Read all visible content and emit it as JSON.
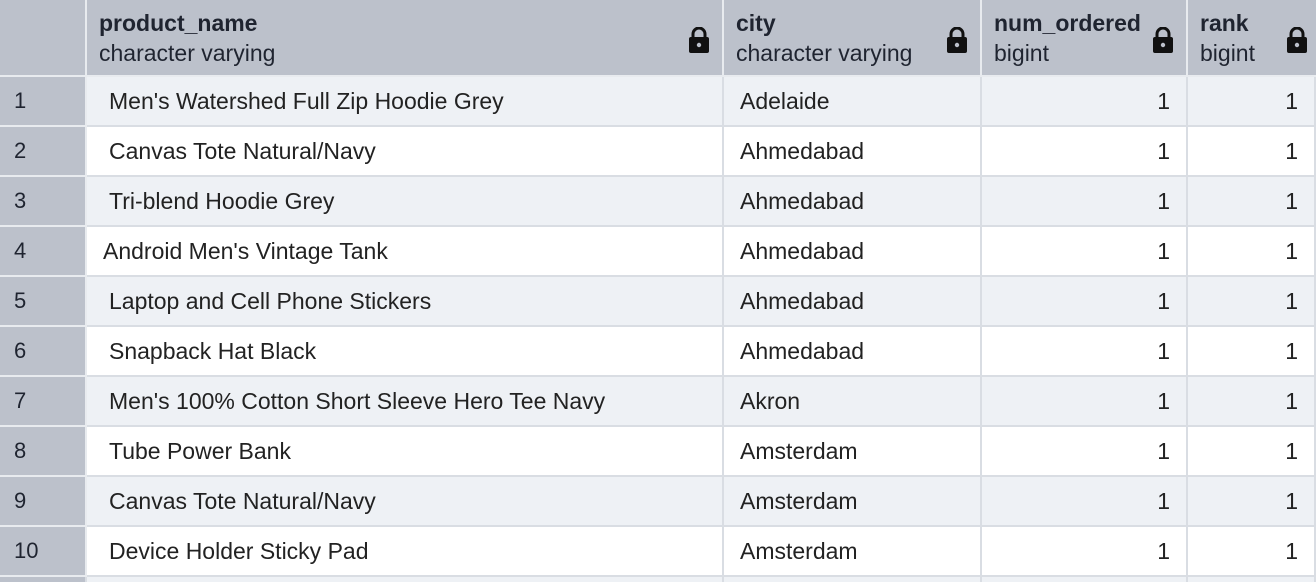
{
  "columns": [
    {
      "name": "product_name",
      "type": "character varying",
      "locked": true,
      "icon": "lock-icon"
    },
    {
      "name": "city",
      "type": "character varying",
      "locked": true,
      "icon": "lock-icon"
    },
    {
      "name": "num_ordered",
      "type": "bigint",
      "locked": true,
      "icon": "lock-icon"
    },
    {
      "name": "rank",
      "type": "bigint",
      "locked": true,
      "icon": "lock-icon"
    }
  ],
  "rows": [
    {
      "n": "1",
      "product_name": "Men's Watershed Full Zip Hoodie Grey",
      "city": "Adelaide",
      "num_ordered": "1",
      "rank": "1"
    },
    {
      "n": "2",
      "product_name": "Canvas Tote Natural/Navy",
      "city": "Ahmedabad",
      "num_ordered": "1",
      "rank": "1"
    },
    {
      "n": "3",
      "product_name": "Tri-blend Hoodie Grey",
      "city": "Ahmedabad",
      "num_ordered": "1",
      "rank": "1"
    },
    {
      "n": "4",
      "product_name": "Android Men's Vintage Tank",
      "city": "Ahmedabad",
      "num_ordered": "1",
      "rank": "1"
    },
    {
      "n": "5",
      "product_name": "Laptop and Cell Phone Stickers",
      "city": "Ahmedabad",
      "num_ordered": "1",
      "rank": "1"
    },
    {
      "n": "6",
      "product_name": "Snapback Hat Black",
      "city": "Ahmedabad",
      "num_ordered": "1",
      "rank": "1"
    },
    {
      "n": "7",
      "product_name": "Men's 100% Cotton Short Sleeve Hero Tee Navy",
      "city": "Akron",
      "num_ordered": "1",
      "rank": "1"
    },
    {
      "n": "8",
      "product_name": "Tube Power Bank",
      "city": "Amsterdam",
      "num_ordered": "1",
      "rank": "1"
    },
    {
      "n": "9",
      "product_name": "Canvas Tote Natural/Navy",
      "city": "Amsterdam",
      "num_ordered": "1",
      "rank": "1"
    },
    {
      "n": "10",
      "product_name": "Device Holder Sticky Pad",
      "city": "Amsterdam",
      "num_ordered": "1",
      "rank": "1"
    }
  ],
  "colors": {
    "header": "#bcc1cb",
    "row_alt": "#eef1f5",
    "row": "#ffffff",
    "grid_line": "#d9dde3"
  }
}
